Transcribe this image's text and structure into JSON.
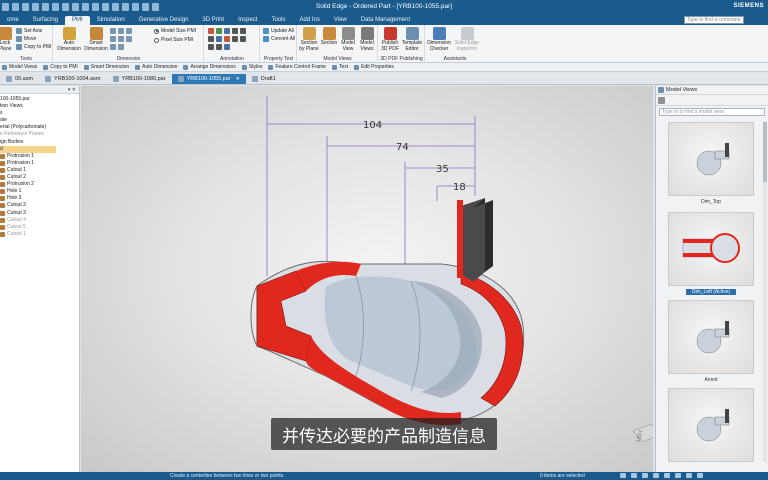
{
  "window": {
    "title": "Solid Edge - Ordered Part - [YRB100-1055.par]",
    "brand": "SIEMENS"
  },
  "ribbon_tabs": [
    {
      "label": "ome",
      "active": false
    },
    {
      "label": "Surfacing",
      "active": false
    },
    {
      "label": "PMI",
      "active": true
    },
    {
      "label": "Simulation",
      "active": false
    },
    {
      "label": "Generative Design",
      "active": false
    },
    {
      "label": "3D Print",
      "active": false
    },
    {
      "label": "Inspect",
      "active": false
    },
    {
      "label": "Tools",
      "active": false
    },
    {
      "label": "Add Ins",
      "active": false
    },
    {
      "label": "View",
      "active": false
    },
    {
      "label": "Data Management",
      "active": false
    }
  ],
  "search": {
    "placeholder": "Type to find a command"
  },
  "ribbon": {
    "tools": {
      "label": "Tools",
      "lock_plane": "Lock\nPlane",
      "set_axis": "Set Axis",
      "move": "Move",
      "copy_to_pmi": "Copy to PMI"
    },
    "dimension": {
      "label": "Dimension",
      "auto_dimension": "Auto\nDimension",
      "smart_dimension": "Smart\nDimension",
      "model_size_pmi": "Model Size PMI",
      "pixel_size_pmi": "Pixel Size PMI"
    },
    "annotation": {
      "label": "Annotation"
    },
    "property_text": {
      "label": "Property Text",
      "update_all": "Update All",
      "convert_all": "Convert All"
    },
    "model_views": {
      "label": "Model Views",
      "section_by_plane": "Section\nby Plane",
      "section": "Section",
      "model_view": "Model\nView",
      "model_views": "Model\nViews"
    },
    "publishing": {
      "label": "3D PDF Publishing",
      "publish_3d_pdf": "Publish\n3D PDF",
      "template_editor": "Template\nEditor"
    },
    "assistants": {
      "label": "Assistants",
      "dimension_checker": "Dimension\nChecker",
      "solid_edge_inspector": "Solid Edge\nInspector"
    }
  },
  "command_bar": [
    "Model Views",
    "Copy to PMI",
    "Smart Dimension",
    "Auto Dimension",
    "Arrange Dimensions",
    "Styles",
    "Feature Control Frame",
    "Text",
    "Edit Properties"
  ],
  "doc_tabs": [
    {
      "label": "00.asm",
      "active": false
    },
    {
      "label": "YRB100-1004.asm",
      "active": false
    },
    {
      "label": "YRB100-1080.par",
      "active": false
    },
    {
      "label": "YRB100-1055.par",
      "active": true
    },
    {
      "label": "Draft1",
      "active": false
    }
  ],
  "pathfinder": {
    "items": [
      {
        "label": "100-1055.par",
        "dim": false,
        "sel": false
      },
      {
        "label": "tion Views",
        "dim": false,
        "sel": false
      },
      {
        "label": "",
        "dim": false,
        "sel": false
      },
      {
        "label": "s",
        "dim": false,
        "sel": false
      },
      {
        "label": "ate",
        "dim": false,
        "sel": false
      },
      {
        "label": "erial (Polycarbonate)",
        "dim": false,
        "sel": false
      },
      {
        "label": "e Reference Planes",
        "dim": true,
        "sel": false
      },
      {
        "label": "ign Bodies",
        "dim": false,
        "sel": false
      },
      {
        "label": "d",
        "dim": false,
        "sel": true
      },
      {
        "label": "Protrusion 1",
        "dim": false,
        "sel": false
      },
      {
        "label": "Protrusion 1",
        "dim": false,
        "sel": false
      },
      {
        "label": "Cutout 1",
        "dim": false,
        "sel": false
      },
      {
        "label": "Cutout 2",
        "dim": false,
        "sel": false
      },
      {
        "label": "Protrusion 2",
        "dim": false,
        "sel": false
      },
      {
        "label": "Hole 1",
        "dim": false,
        "sel": false
      },
      {
        "label": "Hole 3",
        "dim": false,
        "sel": false
      },
      {
        "label": "Cutout 2",
        "dim": false,
        "sel": false
      },
      {
        "label": "Cutout 3",
        "dim": false,
        "sel": false
      },
      {
        "label": "Cutout 4",
        "dim": true,
        "sel": false
      },
      {
        "label": "Cutout 5",
        "dim": true,
        "sel": false
      },
      {
        "label": "Cutout 1",
        "dim": true,
        "sel": false
      }
    ]
  },
  "viewport": {
    "dimensions": [
      "104",
      "74",
      "35",
      "18"
    ],
    "view_cube_label": "LEFT"
  },
  "model_views_panel": {
    "title": "Model Views",
    "search_placeholder": "Type in to find a model view",
    "views": [
      {
        "caption": "Dim_Top",
        "active": false
      },
      {
        "caption": "Dim_Left (Active)",
        "active": true
      },
      {
        "caption": "Annot",
        "active": false
      },
      {
        "caption": "",
        "active": false
      }
    ]
  },
  "status_bar": {
    "message": "Create a centerline between two lines or two points.",
    "selection": "0 items are selected"
  },
  "subtitle": "并传达必要的产品制造信息",
  "colors": {
    "title_blue": "#1a5a8c",
    "section_red": "#e0281e",
    "dimension_purple": "#8a6bc8",
    "part_gray": "#b9c3cf"
  }
}
